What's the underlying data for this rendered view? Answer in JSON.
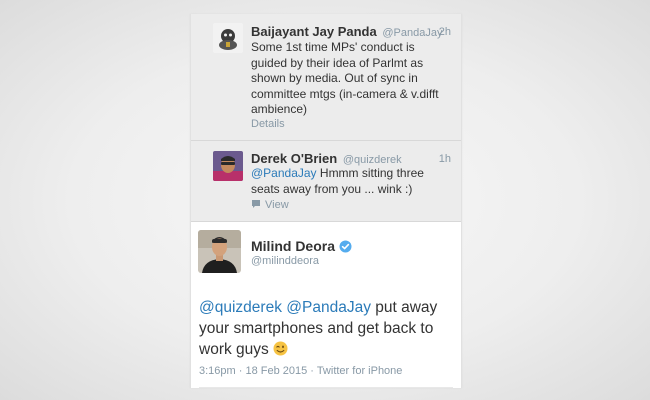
{
  "tweets": [
    {
      "author_name": "Baijayant Jay Panda",
      "author_handle": "@PandaJay",
      "time": "2h",
      "text": "Some 1st time MPs' conduct is guided by their idea of Parlmt as shown by media. Out of sync in committee mtgs (in-camera & v.difft ambience)",
      "footer_label": "Details"
    },
    {
      "author_name": "Derek O'Brien",
      "author_handle": "@quizderek",
      "time": "1h",
      "mention": "@PandaJay",
      "text": " Hmmm sitting three seats away from you ... wink :)",
      "footer_label": "View"
    }
  ],
  "main_tweet": {
    "author_name": "Milind Deora",
    "verified": true,
    "author_handle": "@milinddeora",
    "mention_1": "@quizderek",
    "mention_2": "@PandaJay",
    "text": " put away your smartphones and get back to work guys ",
    "emoji": "winking-face",
    "meta": "3:16pm · 18 Feb 2015 · Twitter for iPhone"
  },
  "colors": {
    "link": "#2b7bb9",
    "muted": "#8899a6",
    "text": "#333333",
    "verified": "#55acee",
    "prev_tweet_bg": "#ececec"
  }
}
